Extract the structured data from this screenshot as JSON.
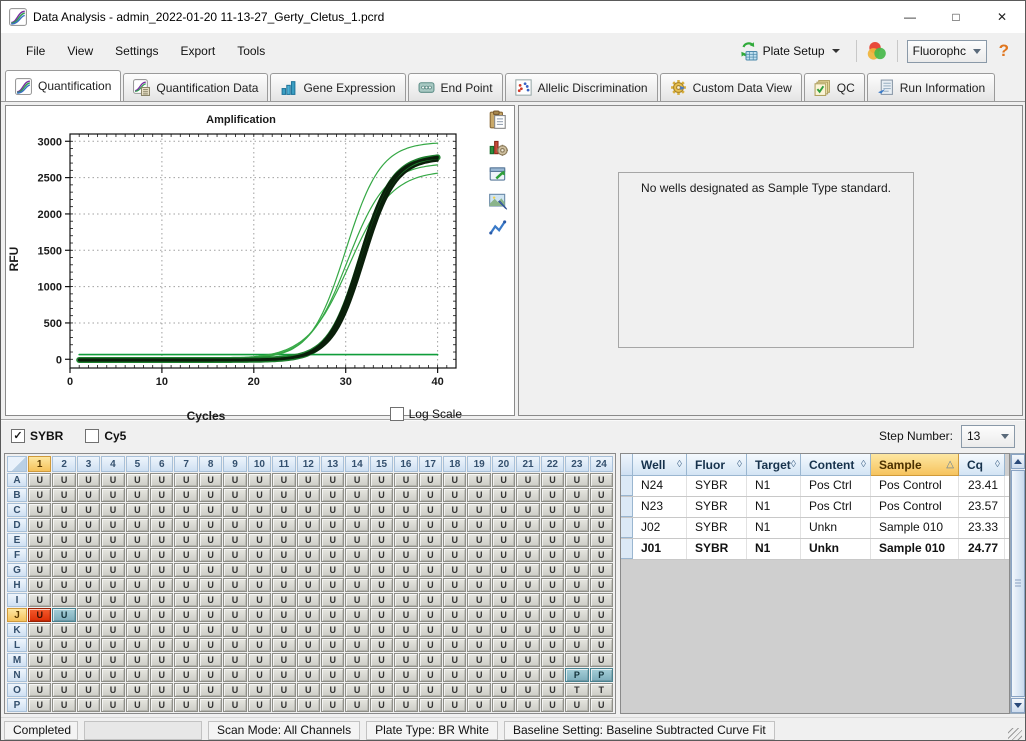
{
  "window": {
    "title": "Data Analysis - admin_2022-01-20 11-13-27_Gerty_Cletus_1.pcrd"
  },
  "menubar": {
    "menus": [
      "File",
      "View",
      "Settings",
      "Export",
      "Tools"
    ],
    "plate_setup_label": "Plate Setup",
    "fluor_combo_value": "Fluorophc",
    "help_label": "?"
  },
  "tabs": [
    {
      "label": "Quantification",
      "icon": "amplification-chart-icon",
      "active": true
    },
    {
      "label": "Quantification Data",
      "icon": "amplification-data-icon",
      "active": false
    },
    {
      "label": "Gene Expression",
      "icon": "bar-chart-icon",
      "active": false
    },
    {
      "label": "End Point",
      "icon": "end-point-icon",
      "active": false
    },
    {
      "label": "Allelic Discrimination",
      "icon": "allelic-scatter-icon",
      "active": false
    },
    {
      "label": "Custom Data View",
      "icon": "gear-icon",
      "active": false
    },
    {
      "label": "QC",
      "icon": "qc-pages-icon",
      "active": false
    },
    {
      "label": "Run Information",
      "icon": "run-info-icon",
      "active": false
    }
  ],
  "chart_data": {
    "type": "line",
    "title": "Amplification",
    "xlabel": "Cycles",
    "ylabel": "RFU",
    "xlim": [
      0,
      42
    ],
    "ylim": [
      -120,
      3100
    ],
    "xticks": [
      0,
      10,
      20,
      30,
      40
    ],
    "yticks": [
      0,
      500,
      1000,
      1500,
      2000,
      2500,
      3000
    ],
    "grid": "dotted",
    "legend": "none",
    "log_scale_label": "Log Scale",
    "sample_cycles": [
      1,
      5,
      10,
      15,
      20,
      25,
      30,
      35,
      40
    ],
    "series": [
      {
        "name": "non-amplifying well (flat ~65 RFU)",
        "color": "#0f9d3a",
        "width": 1.6,
        "model": {
          "flat": 65
        },
        "rfu": [
          65,
          65,
          65,
          65,
          65,
          65,
          65,
          65,
          65
        ]
      },
      {
        "name": "amplified well 1",
        "color": "#35a845",
        "width": 1.2,
        "model": {
          "base": 8,
          "plateau": 2990,
          "midpoint": 30.0,
          "slope": 1.9
        },
        "rfu": [
          8,
          8,
          9,
          12,
          40,
          210,
          1500,
          2790,
          2975
        ]
      },
      {
        "name": "amplified well 2",
        "color": "#35a845",
        "width": 1.2,
        "model": {
          "base": 8,
          "plateau": 2700,
          "midpoint": 30.2,
          "slope": 2.1
        },
        "rfu": [
          8,
          8,
          9,
          13,
          45,
          215,
          1290,
          2450,
          2675
        ]
      },
      {
        "name": "amplified well 3",
        "color": "#35a845",
        "width": 1.2,
        "model": {
          "base": 8,
          "plateau": 2600,
          "midpoint": 30.4,
          "slope": 2.3
        },
        "rfu": [
          8,
          8,
          9,
          14,
          50,
          225,
          1190,
          2290,
          2560
        ]
      },
      {
        "name": "amplified well cluster A",
        "color": "#0a1f0a",
        "width": 2.4,
        "model": {
          "base": -10,
          "plateau": 2790,
          "midpoint": 31.5,
          "slope": 1.7
        },
        "rfu": [
          -10,
          -10,
          -9,
          -6,
          10,
          55,
          790,
          2450,
          2770
        ]
      },
      {
        "name": "amplified well cluster B",
        "color": "#0a1f0a",
        "width": 2.4,
        "model": {
          "base": -15,
          "plateau": 2810,
          "midpoint": 31.8,
          "slope": 1.75
        },
        "rfu": [
          -15,
          -15,
          -14,
          -11,
          5,
          45,
          700,
          2400,
          2780
        ]
      },
      {
        "name": "amplified well cluster C",
        "color": "#0a1f0a",
        "width": 2.4,
        "model": {
          "base": -5,
          "plateau": 2760,
          "midpoint": 32.0,
          "slope": 1.7
        },
        "rfu": [
          -5,
          -5,
          -4,
          -1,
          12,
          40,
          640,
          2330,
          2735
        ]
      }
    ],
    "cluster_halo": {
      "color": "#1e7f2e",
      "width": 6,
      "model": {
        "base": -10,
        "plateau": 2800,
        "midpoint": 31.7,
        "slope": 1.72
      }
    }
  },
  "chart_tools": [
    {
      "name": "copy-chart-icon"
    },
    {
      "name": "chart-settings-icon"
    },
    {
      "name": "export-chart-icon"
    },
    {
      "name": "save-image-icon"
    },
    {
      "name": "trace-styles-icon"
    }
  ],
  "right_panel": {
    "message": "No wells designated as Sample Type standard."
  },
  "filter_bar": {
    "checkboxes": [
      {
        "label": "SYBR",
        "checked": true
      },
      {
        "label": "Cy5",
        "checked": false
      }
    ],
    "step_number_label": "Step Number:",
    "step_number_value": "13"
  },
  "plate": {
    "columns": [
      "1",
      "2",
      "3",
      "4",
      "5",
      "6",
      "7",
      "8",
      "9",
      "10",
      "11",
      "12",
      "13",
      "14",
      "15",
      "16",
      "17",
      "18",
      "19",
      "20",
      "21",
      "22",
      "23",
      "24"
    ],
    "rows": [
      "A",
      "B",
      "C",
      "D",
      "E",
      "F",
      "G",
      "H",
      "I",
      "J",
      "K",
      "L",
      "M",
      "N",
      "O",
      "P"
    ],
    "default_well": "U",
    "selected_column": "1",
    "selected_row": "J",
    "special_wells": [
      {
        "row": "J",
        "col": "1",
        "label": "U",
        "state": "active"
      },
      {
        "row": "J",
        "col": "2",
        "label": "U",
        "state": "selected"
      },
      {
        "row": "N",
        "col": "23",
        "label": "P",
        "state": "selected"
      },
      {
        "row": "N",
        "col": "24",
        "label": "P",
        "state": "selected"
      },
      {
        "row": "O",
        "col": "23",
        "label": "T",
        "state": "default"
      },
      {
        "row": "O",
        "col": "24",
        "label": "T",
        "state": "default"
      }
    ]
  },
  "well_table": {
    "columns": [
      {
        "label": "Well",
        "sort_icon": "diamond",
        "highlighted": false
      },
      {
        "label": "Fluor",
        "sort_icon": "diamond",
        "highlighted": false
      },
      {
        "label": "Target",
        "sort_icon": "diamond",
        "highlighted": false
      },
      {
        "label": "Content",
        "sort_icon": "diamond",
        "highlighted": false
      },
      {
        "label": "Sample",
        "sort_icon": "triangle-up",
        "highlighted": true
      },
      {
        "label": "Cq",
        "sort_icon": "diamond",
        "highlighted": false
      }
    ],
    "rows": [
      {
        "well": "N24",
        "fluor": "SYBR",
        "target": "N1",
        "content": "Pos Ctrl",
        "sample": "Pos Control",
        "cq": "23.41",
        "bold": false
      },
      {
        "well": "N23",
        "fluor": "SYBR",
        "target": "N1",
        "content": "Pos Ctrl",
        "sample": "Pos Control",
        "cq": "23.57",
        "bold": false
      },
      {
        "well": "J02",
        "fluor": "SYBR",
        "target": "N1",
        "content": "Unkn",
        "sample": "Sample 010",
        "cq": "23.33",
        "bold": false
      },
      {
        "well": "J01",
        "fluor": "SYBR",
        "target": "N1",
        "content": "Unkn",
        "sample": "Sample 010",
        "cq": "24.77",
        "bold": true
      }
    ]
  },
  "statusbar": {
    "items": [
      {
        "text": "Completed"
      },
      {
        "text": ""
      },
      {
        "text": "Scan Mode: All Channels"
      },
      {
        "text": "Plate Type: BR White"
      },
      {
        "text": "Baseline Setting: Baseline Subtracted Curve Fit"
      }
    ]
  }
}
